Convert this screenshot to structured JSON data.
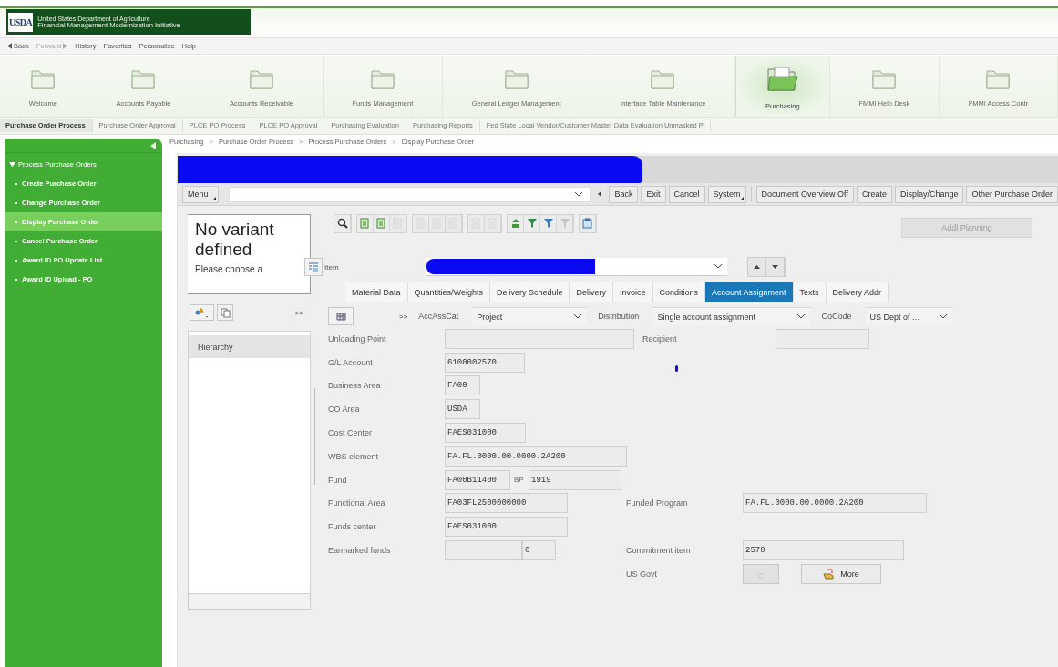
{
  "header": {
    "logo": "USDA",
    "agency": "United States Department of Agriculture",
    "initiative": "Financial Management Modernization Initiative"
  },
  "nav": [
    {
      "label": "Back",
      "kind": "back",
      "disabled": false
    },
    {
      "label": "Forward",
      "kind": "forward",
      "disabled": true
    },
    {
      "label": "History",
      "kind": "menu",
      "disabled": false
    },
    {
      "label": "Favorites",
      "kind": "menu",
      "disabled": false
    },
    {
      "label": "Personalize",
      "kind": "menu",
      "disabled": false
    },
    {
      "label": "Help",
      "kind": "menu",
      "disabled": false
    }
  ],
  "top_tabs": [
    {
      "label": "Welcome",
      "selected": false
    },
    {
      "label": "Accounts Payable",
      "selected": false
    },
    {
      "label": "Accounts Receivable",
      "selected": false
    },
    {
      "label": "Funds Management",
      "selected": false
    },
    {
      "label": "General Ledger Management",
      "selected": false
    },
    {
      "label": "Interface Table Maintenance",
      "selected": false
    },
    {
      "label": "Purchasing",
      "selected": true
    },
    {
      "label": "FMMI Help Desk",
      "selected": false
    },
    {
      "label": "FMMI Access Contr",
      "selected": false
    }
  ],
  "sub_tabs": [
    {
      "label": "Purchase Order Process",
      "selected": true
    },
    {
      "label": "Purchase Order Approval",
      "selected": false
    },
    {
      "label": "PLCE PO Process",
      "selected": false
    },
    {
      "label": "PLCE PO Approval",
      "selected": false
    },
    {
      "label": "Purchasing Evaluation",
      "selected": false
    },
    {
      "label": "Purchasing Reports",
      "selected": false
    },
    {
      "label": "Fed State Local Vendor/Customer Master Data Evaluation Unmasked P",
      "selected": false
    }
  ],
  "sidebar": {
    "items": [
      {
        "label": "Process Purchase Orders",
        "expanded": true,
        "children": [
          {
            "label": "Create Purchase Order",
            "selected": false
          },
          {
            "label": "Change Purchase Order",
            "selected": false
          },
          {
            "label": "Display Purchase Order",
            "selected": true
          },
          {
            "label": "Cancel Purchase Order",
            "selected": false
          },
          {
            "label": "Award ID PO Update List",
            "selected": false
          },
          {
            "label": "Award ID Upload - PO",
            "selected": false
          }
        ]
      }
    ]
  },
  "breadcrumb": [
    {
      "kind": "link",
      "text": "Purchasing"
    },
    {
      "kind": "sep",
      "text": ">"
    },
    {
      "kind": "link",
      "text": "Purchase Order Process"
    },
    {
      "kind": "sep",
      "text": ">"
    },
    {
      "kind": "link",
      "text": "Process Purchase Orders"
    },
    {
      "kind": "sep",
      "text": ">"
    },
    {
      "kind": "link",
      "text": "Display Purchase Order"
    }
  ],
  "toolbar": {
    "menu": "Menu",
    "buttons": [
      {
        "label": "Back",
        "kind": "plain"
      },
      {
        "label": "Exit",
        "kind": "plain"
      },
      {
        "label": "Cancel",
        "kind": "plain"
      },
      {
        "label": "System",
        "kind": "menu"
      },
      {
        "label": "Document Overview Off",
        "kind": "plain"
      },
      {
        "label": "Create",
        "kind": "plain"
      },
      {
        "label": "Display/Change",
        "kind": "plain"
      },
      {
        "label": "Other Purchase Order",
        "kind": "plain"
      }
    ]
  },
  "variant_pane": {
    "title": "No variant defined",
    "prompt": "Please choose a",
    "expand": ">>",
    "list_header": "Hierarchy"
  },
  "icon_toolbar": [
    [
      {
        "kind": "zoom",
        "disabled": false
      }
    ],
    [
      {
        "kind": "doc",
        "disabled": false
      },
      {
        "kind": "doc",
        "disabled": false
      },
      {
        "kind": "doc",
        "disabled": true
      }
    ],
    [
      {
        "kind": "doc",
        "disabled": true
      },
      {
        "kind": "doc",
        "disabled": true
      },
      {
        "kind": "doc",
        "disabled": true
      }
    ],
    [
      {
        "kind": "doc",
        "disabled": true
      },
      {
        "kind": "doc",
        "disabled": true
      }
    ],
    [
      {
        "kind": "tree",
        "disabled": false
      },
      {
        "kind": "filter",
        "disabled": false
      },
      {
        "kind": "filter",
        "disabled": false
      },
      {
        "kind": "filter",
        "disabled": true
      }
    ],
    [
      {
        "kind": "clipboard",
        "disabled": false
      }
    ]
  ],
  "addl_planning": {
    "label": "Addl Planning",
    "disabled": true
  },
  "item": {
    "label": "Item"
  },
  "item_tabs": [
    {
      "label": "Material Data",
      "selected": false
    },
    {
      "label": "Quantities/Weights",
      "selected": false
    },
    {
      "label": "Delivery Schedule",
      "selected": false
    },
    {
      "label": "Delivery",
      "selected": false
    },
    {
      "label": "Invoice",
      "selected": false
    },
    {
      "label": "Conditions",
      "selected": false
    },
    {
      "label": "Account Assignment",
      "selected": true
    },
    {
      "label": "Texts",
      "selected": false
    },
    {
      "label": "Delivery Addr",
      "selected": false
    }
  ],
  "assignment": {
    "expand": ">>",
    "selects": [
      {
        "label": "AccAssCat",
        "value": "Project"
      },
      {
        "label": "Distribution",
        "value": "Single account assignment"
      },
      {
        "label": "CoCode",
        "value": "US Dept of ..."
      }
    ]
  },
  "rows": [
    {
      "label": "Unloading Point",
      "parts": [
        {
          "kind": "field"
        }
      ],
      "side": {
        "label": "Recipient",
        "parts": [
          {
            "kind": "field"
          }
        ]
      }
    },
    {
      "label": "G/L Account",
      "parts": [
        {
          "kind": "field",
          "value": "6100002570"
        }
      ]
    },
    {
      "label": "Business Area",
      "parts": [
        {
          "kind": "field",
          "value": "FA00"
        }
      ]
    },
    {
      "label": "CO Area",
      "parts": [
        {
          "kind": "field",
          "value": "USDA"
        }
      ]
    },
    {
      "label": "Cost Center",
      "parts": [
        {
          "kind": "field",
          "value": "FAES031000"
        }
      ]
    },
    {
      "label": "WBS element",
      "parts": [
        {
          "kind": "field",
          "value": "FA.FL.0000.00.0000.2A200"
        }
      ]
    },
    {
      "label": "Fund",
      "parts": [
        {
          "kind": "field",
          "value": "FA00B11400"
        },
        {
          "kind": "text",
          "text": "BP"
        },
        {
          "kind": "field",
          "value": "1919"
        }
      ]
    },
    {
      "label": "Functional Area",
      "parts": [
        {
          "kind": "field",
          "value": "FA03FL2500000000"
        }
      ],
      "side": {
        "label": "Funded Program",
        "parts": [
          {
            "kind": "field",
            "value": "FA.FL.0000.00.0000.2A200"
          }
        ]
      }
    },
    {
      "label": "Funds center",
      "parts": [
        {
          "kind": "field",
          "value": "FAES031000"
        }
      ]
    },
    {
      "label": "Earmarked funds",
      "parts": [
        {
          "kind": "field"
        },
        {
          "kind": "field",
          "value": "0"
        }
      ],
      "side": {
        "label": "Commitment item",
        "parts": [
          {
            "kind": "field",
            "value": "2570"
          }
        ]
      }
    },
    {
      "side": {
        "label": "US Govt",
        "parts": [
          {
            "kind": "icon-button",
            "disabled": true
          },
          {
            "kind": "button",
            "label": "More"
          }
        ]
      }
    }
  ]
}
